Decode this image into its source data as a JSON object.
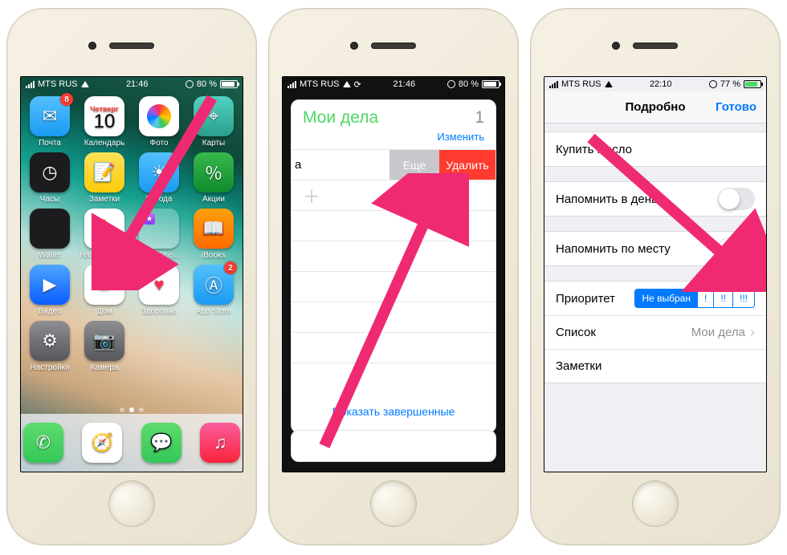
{
  "status": {
    "carrier": "MTS RUS",
    "time1": "21:46",
    "time2": "21:46",
    "time3": "22:10",
    "battery12": "80 %",
    "battery3": "77 %",
    "battery12_fill": 80,
    "battery3_fill": 77
  },
  "home": {
    "badge_mail": "8",
    "badge_appstore": "2",
    "calendar_weekday": "Четверг",
    "calendar_day": "10",
    "apps": {
      "mail": "Почта",
      "calendar": "Календарь",
      "photos": "Фото",
      "maps": "Карты",
      "clock": "Часы",
      "notes": "Заметки",
      "weather": "Погода",
      "stocks": "Акции",
      "wallet": "Wallet",
      "reminders": "Напоминания",
      "folder": "Apple-iPhon…",
      "ibooks": "iBooks",
      "videos": "Видео",
      "home_app": "Дом",
      "health": "Здоровье",
      "appstore": "App Store",
      "settings": "Настройки",
      "camera": "Камера",
      "itunes": "iTunes Store"
    }
  },
  "reminders_list": {
    "title": "Мои дела",
    "count": "1",
    "edit": "Изменить",
    "swipe_item_placeholder": "а",
    "action_more": "Еще",
    "action_delete": "Удалить",
    "show_completed": "Показать завершенные"
  },
  "detail": {
    "nav_title": "Подробно",
    "nav_done": "Готово",
    "item_title": "Купить масло",
    "remind_day": "Напомнить в день",
    "remind_place": "Напомнить по месту",
    "priority_label": "Приоритет",
    "priority_opts": {
      "none": "Не выбран",
      "l": "!",
      "m": "!!",
      "h": "!!!"
    },
    "list_label": "Список",
    "list_value": "Мои дела",
    "notes_label": "Заметки"
  }
}
